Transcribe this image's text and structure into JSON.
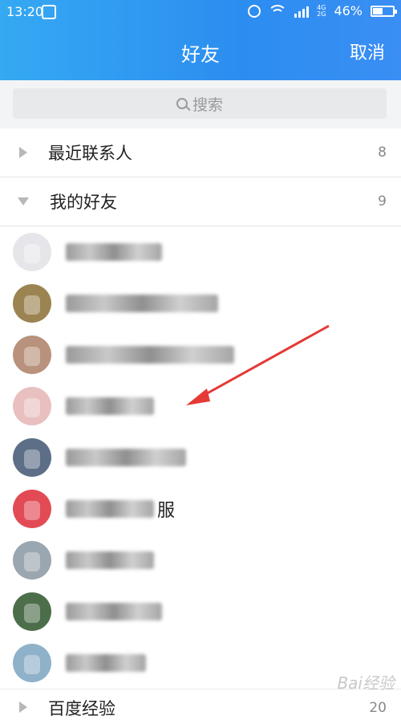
{
  "status_bar": {
    "time": "13:20",
    "battery": "46%",
    "battery_level": 0.46
  },
  "header": {
    "title": "好友",
    "cancel_label": "取消"
  },
  "search": {
    "placeholder": "搜索"
  },
  "groups": [
    {
      "label": "最近联系人",
      "count": "8",
      "expanded": false
    },
    {
      "label": "我的好友",
      "count": "9",
      "expanded": true
    },
    {
      "label": "百度经验",
      "count": "20",
      "expanded": false
    }
  ],
  "friends": [
    {
      "visible_suffix": "",
      "avatar_color": "#e6e6ea"
    },
    {
      "visible_suffix": "",
      "avatar_color": "#9b8452"
    },
    {
      "visible_suffix": "",
      "avatar_color": "#b8927c"
    },
    {
      "visible_suffix": "",
      "avatar_color": "#e8c0bf"
    },
    {
      "visible_suffix": "",
      "avatar_color": "#5c6f86"
    },
    {
      "visible_suffix": "服",
      "avatar_color": "#e24b55"
    },
    {
      "visible_suffix": "",
      "avatar_color": "#9aa6b0"
    },
    {
      "visible_suffix": "",
      "avatar_color": "#4d6e4a"
    },
    {
      "visible_suffix": "",
      "avatar_color": "#8fb1c9"
    }
  ],
  "watermark": "Bai经验",
  "colors": {
    "header_start": "#35a9f2",
    "header_end": "#2c8df0",
    "arrow": "#e53935"
  }
}
